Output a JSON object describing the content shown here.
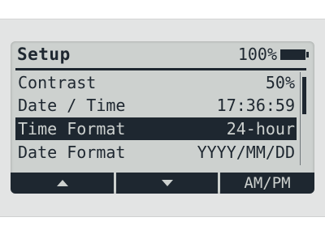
{
  "screen": {
    "title": "Setup",
    "battery_percent": "100%",
    "battery_icon": "battery-full-icon"
  },
  "settings": [
    {
      "label": "Contrast",
      "value": "50%",
      "selected": false
    },
    {
      "label": "Date / Time",
      "value": "17:36:59",
      "selected": false
    },
    {
      "label": "Time Format",
      "value": "24-hour",
      "selected": true
    },
    {
      "label": "Date Format",
      "value": "YYYY/MM/DD",
      "selected": false
    }
  ],
  "softkeys": {
    "up_icon": "up-arrow-icon",
    "down_icon": "down-arrow-icon",
    "right_label": "AM/PM"
  },
  "colors": {
    "lcd_background": "#cdd1cf",
    "ink": "#1e2730",
    "bezel": "#e3e4e4"
  }
}
